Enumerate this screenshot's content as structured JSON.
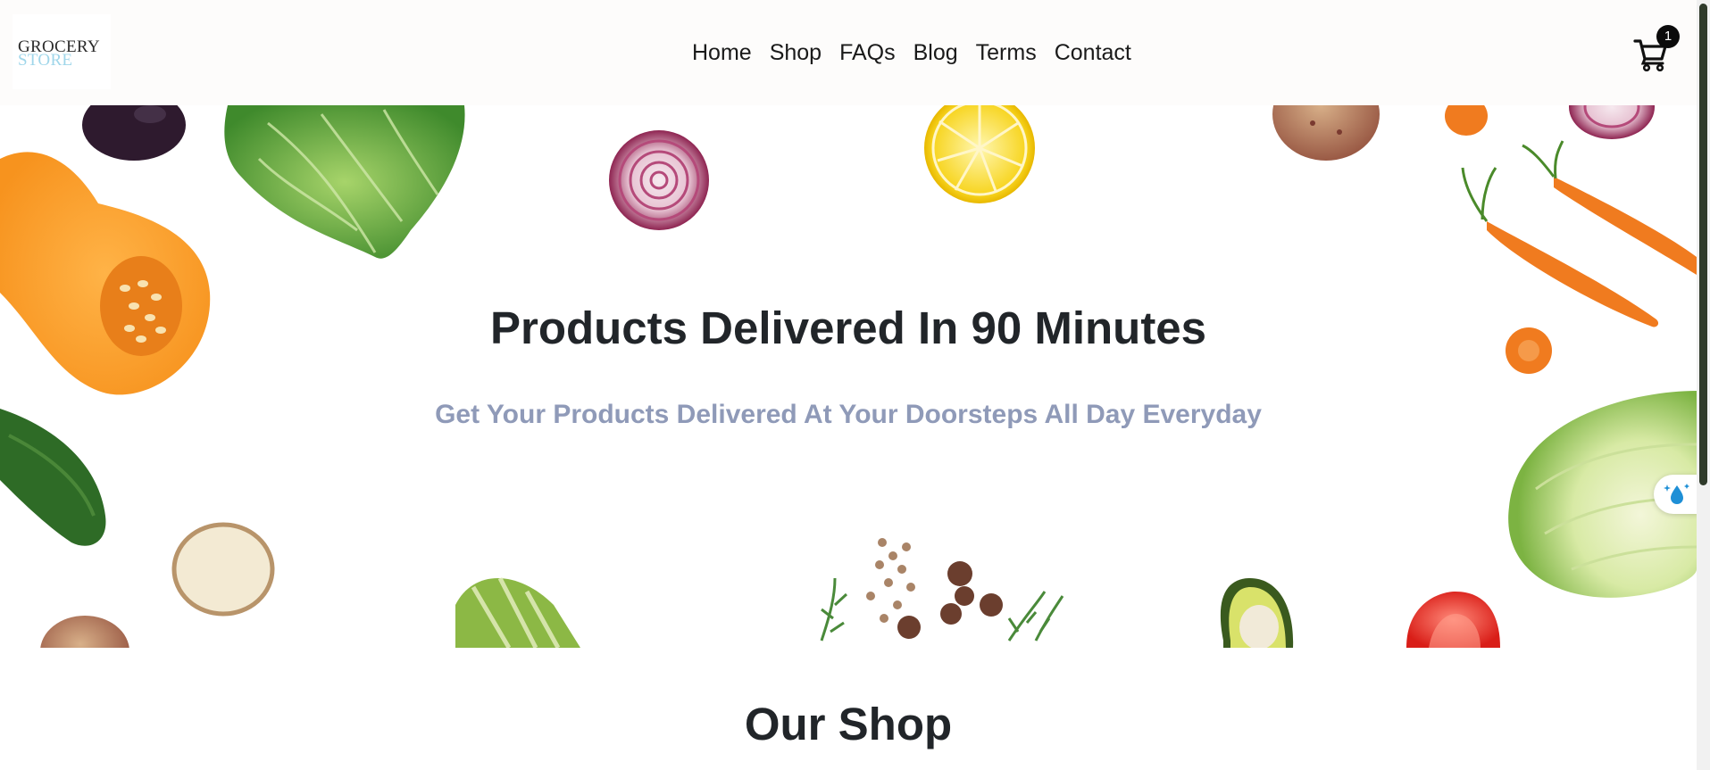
{
  "header": {
    "logo": {
      "line1": "GROCERY",
      "line2": "STORE"
    },
    "nav": [
      "Home",
      "Shop",
      "FAQs",
      "Blog",
      "Terms",
      "Contact"
    ],
    "cart": {
      "icon": "cart-icon",
      "count": "1"
    }
  },
  "hero": {
    "title": "Products Delivered In 90 Minutes",
    "subtitle": "Get Your Products Delivered At Your Doorsteps All Day Everyday",
    "decor": [
      "eggplant",
      "savoy-cabbage",
      "red-onion",
      "lemon-slice",
      "potato",
      "carrot",
      "butternut-squash",
      "zucchini",
      "potato-half",
      "cucumber",
      "spices",
      "rosemary",
      "avocado",
      "tomato",
      "cabbage-half"
    ],
    "floating_button_icon": "water-drop-sparkle-icon"
  },
  "shop": {
    "title": "Our Shop"
  },
  "colors": {
    "header_bg": "#fdfcfb",
    "title": "#212529",
    "subtitle": "#8f9ab8",
    "logo_accent": "#9fd6ea",
    "scroll_thumb": "#2f3a2a"
  }
}
